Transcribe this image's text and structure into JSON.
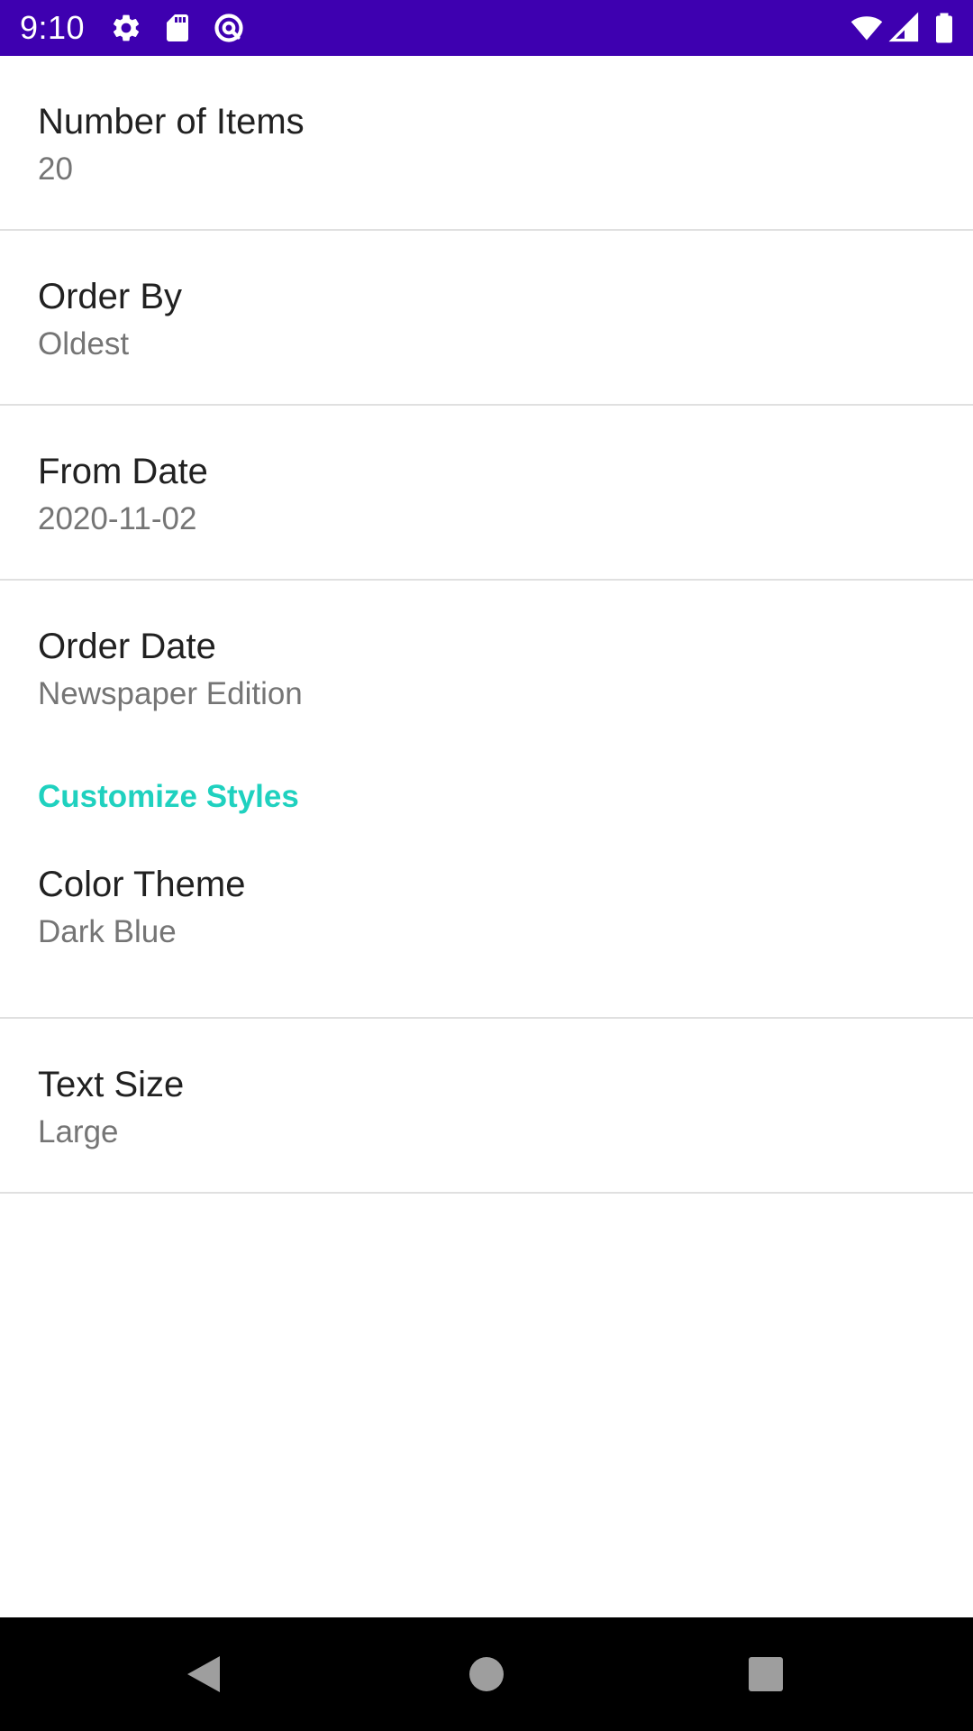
{
  "status_bar": {
    "time": "9:10",
    "background_color": "#3e00b0",
    "left_icons": [
      "settings-gear-icon",
      "sd-card-icon",
      "sync-icon"
    ],
    "right_icons": [
      "wifi-icon",
      "cell-signal-icon",
      "battery-icon"
    ]
  },
  "preferences": {
    "items": [
      {
        "title": "Number of Items",
        "summary": "20"
      },
      {
        "title": "Order By",
        "summary": "Oldest"
      },
      {
        "title": "From Date",
        "summary": "2020-11-02"
      },
      {
        "title": "Order Date",
        "summary": "Newspaper Edition"
      }
    ],
    "category": {
      "title": "Customize Styles",
      "accent_color": "#1fd1bf"
    },
    "style_items": [
      {
        "title": "Color Theme",
        "summary": "Dark Blue"
      },
      {
        "title": "Text Size",
        "summary": "Large"
      }
    ]
  },
  "nav_bar": {
    "buttons": [
      "back-icon",
      "home-icon",
      "recents-icon"
    ]
  }
}
